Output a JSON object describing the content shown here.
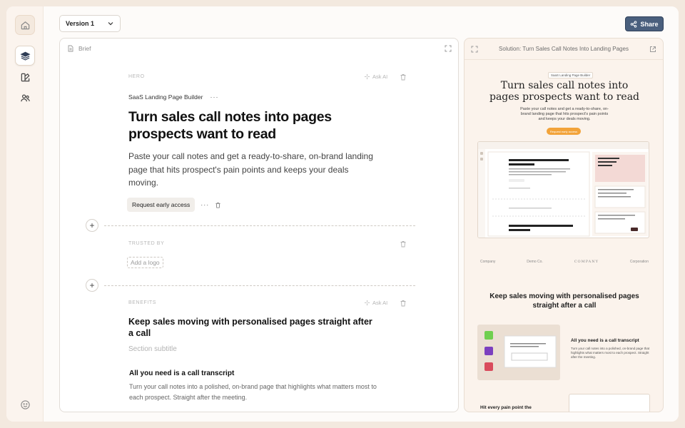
{
  "sidebar": {
    "items": [
      {
        "name": "home-icon"
      },
      {
        "name": "layers-icon",
        "active": true
      },
      {
        "name": "palette-icon"
      },
      {
        "name": "users-icon"
      }
    ],
    "bottom_icon": "smiley-icon"
  },
  "toolbar": {
    "version_label": "Version 1",
    "share_label": "Share"
  },
  "editor": {
    "header_label": "Brief",
    "ask_ai_label": "Ask AI",
    "hero": {
      "section_label": "HERO",
      "eyebrow": "SaaS Landing Page Builder",
      "title": "Turn sales call notes into pages prospects want to read",
      "subtitle": "Paste your call notes and get a ready-to-share, on-brand landing page that hits prospect's pain points and keeps your deals moving.",
      "cta_label": "Request early access"
    },
    "trusted": {
      "section_label": "TRUSTED BY",
      "add_logo_label": "Add a logo"
    },
    "benefits": {
      "section_label": "BENEFITS",
      "title": "Keep sales moving with personalised pages straight after a call",
      "subtitle_placeholder": "Section subtitle",
      "item_title": "All you need is a call transcript",
      "item_text": "Turn your call notes into a polished, on-brand page that highlights what matters most to each prospect. Straight after the meeting."
    }
  },
  "preview": {
    "title": "Solution: Turn Sales Call Notes Into Landing Pages",
    "tag": "SaaS Landing Page Builder",
    "hero_title": "Turn sales call notes into pages prospects want to read",
    "hero_sub": "Paste your call notes and get a ready-to-share, on-brand landing page that hits prospect's pain points and keeps your deals moving.",
    "cta_label": "Request early access",
    "logos": [
      "Company",
      "Demo Co.",
      "COMPANY",
      "Corporation"
    ],
    "section_title": "Keep sales moving with personalised pages straight after a call",
    "card_title": "All you need is a call transcript",
    "card_text": "Turn your call notes into a polished, on-brand page that highlights what matters most to each prospect. Straight after the meeting.",
    "next_title": "Hit every pain point the"
  },
  "colors": {
    "page_bg": "#f3e9df",
    "share_button": "#4a5f7d",
    "preview_cta": "#f2a33a"
  }
}
